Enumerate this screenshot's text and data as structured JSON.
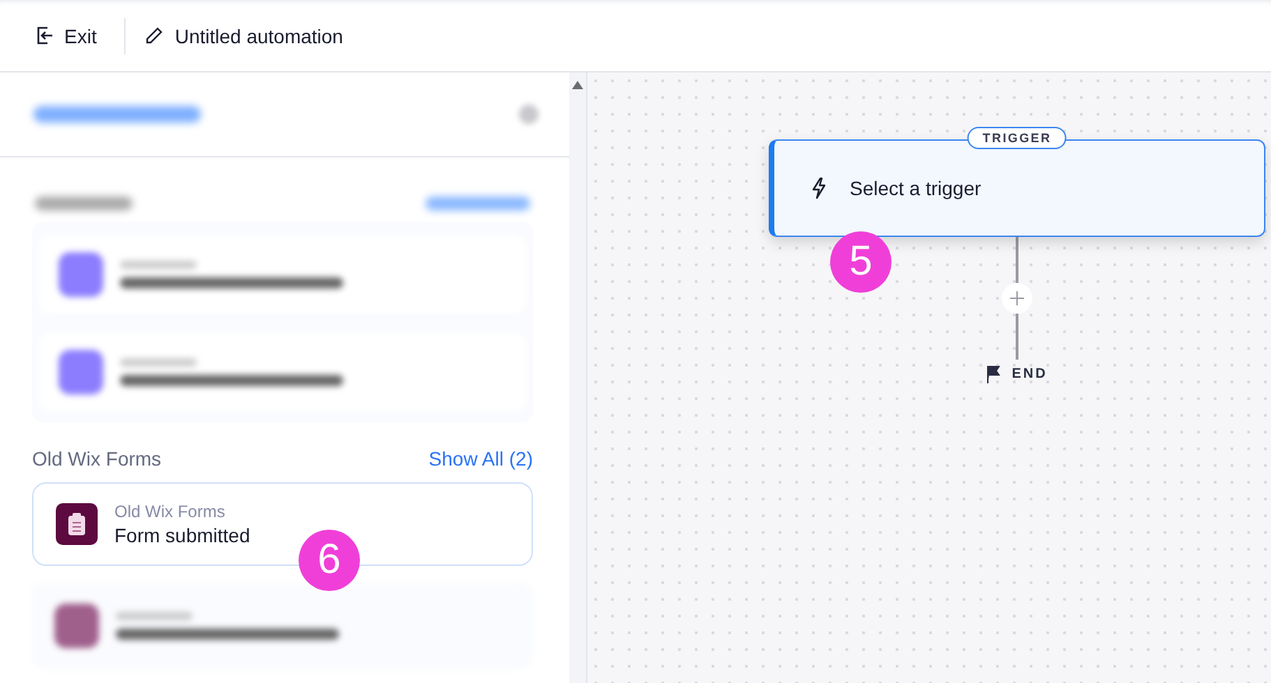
{
  "topbar": {
    "exit_label": "Exit",
    "title": "Untitled automation"
  },
  "sections": [
    {
      "kind": "blurred",
      "cards": [
        {
          "color": "#8c7dff"
        },
        {
          "color": "#8c7dff"
        }
      ]
    },
    {
      "kind": "clear",
      "title": "Old Wix Forms",
      "link": "Show All (2)",
      "cards": [
        {
          "kind": "clear",
          "app": "Old Wix Forms",
          "event": "Form submitted",
          "color": "#5c0a3f"
        },
        {
          "kind": "blurred",
          "color": "#a0608c"
        }
      ]
    }
  ],
  "trigger": {
    "tag": "TRIGGER",
    "label": "Select a trigger"
  },
  "end_label": "END",
  "markers": [
    {
      "label": "5"
    },
    {
      "label": "6"
    }
  ]
}
